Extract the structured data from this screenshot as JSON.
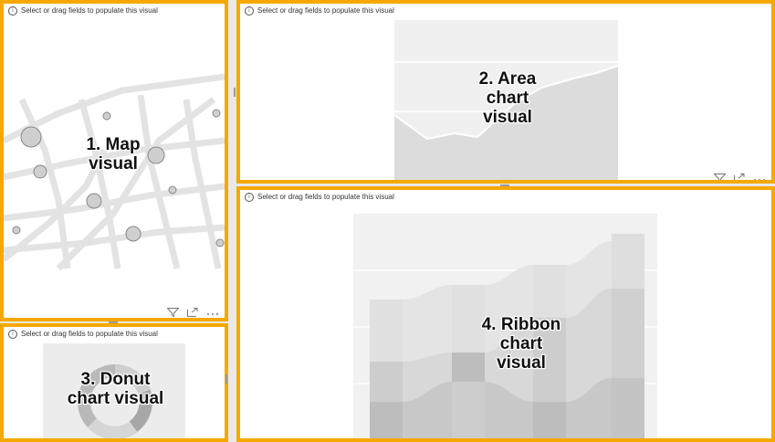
{
  "hint_text": "Select or drag fields to populate this visual",
  "visuals": {
    "map": {
      "label_line1": "1. Map",
      "label_line2": "visual"
    },
    "area": {
      "label_line1": "2. Area",
      "label_line2": "chart",
      "label_line3": "visual"
    },
    "donut": {
      "label_line1": "3. Donut",
      "label_line2": "chart visual"
    },
    "ribbon": {
      "label_line1": "4. Ribbon",
      "label_line2": "chart",
      "label_line3": "visual"
    }
  },
  "colors": {
    "highlight_border": "#f5a800",
    "placeholder_gray": "#d9d9d9"
  },
  "icons": [
    "info-icon",
    "filter-icon",
    "focus-mode-icon",
    "more-options-icon"
  ]
}
